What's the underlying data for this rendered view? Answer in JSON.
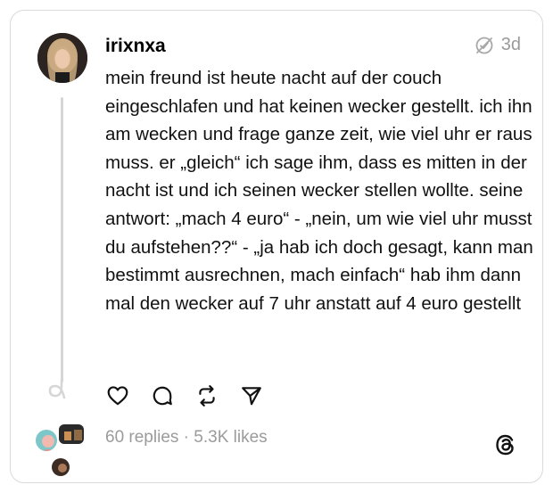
{
  "post": {
    "username": "irixnxa",
    "age": "3d",
    "text": "mein freund ist heute nacht auf der couch eingeschlafen und hat keinen wecker gestellt. ich ihn am wecken und frage ganze zeit, wie viel uhr er raus muss. er „gleich“ ich sage ihm, dass es mitten in der nacht ist und ich seinen wecker stellen wollte. seine antwort: „mach 4 euro“ - „nein, um wie viel uhr musst du aufstehen??“ - „ja hab ich doch gesagt, kann man bestimmt ausrechnen, mach einfach“ hab ihm dann mal den wecker auf 7 uhr anstatt auf 4 euro gestellt",
    "replies": "60 replies",
    "separator": "·",
    "likes": "5.3K likes"
  },
  "icons": {
    "avatar": "profile-photo",
    "verified_meta": "clock-slash-icon",
    "like": "heart-icon",
    "comment": "comment-icon",
    "repost": "repost-icon",
    "share": "send-icon",
    "brand": "threads-logo"
  },
  "colors": {
    "text": "#111111",
    "muted": "#9a9a9a",
    "border": "#d9d9d9",
    "thread_line": "#d6d6d6"
  }
}
